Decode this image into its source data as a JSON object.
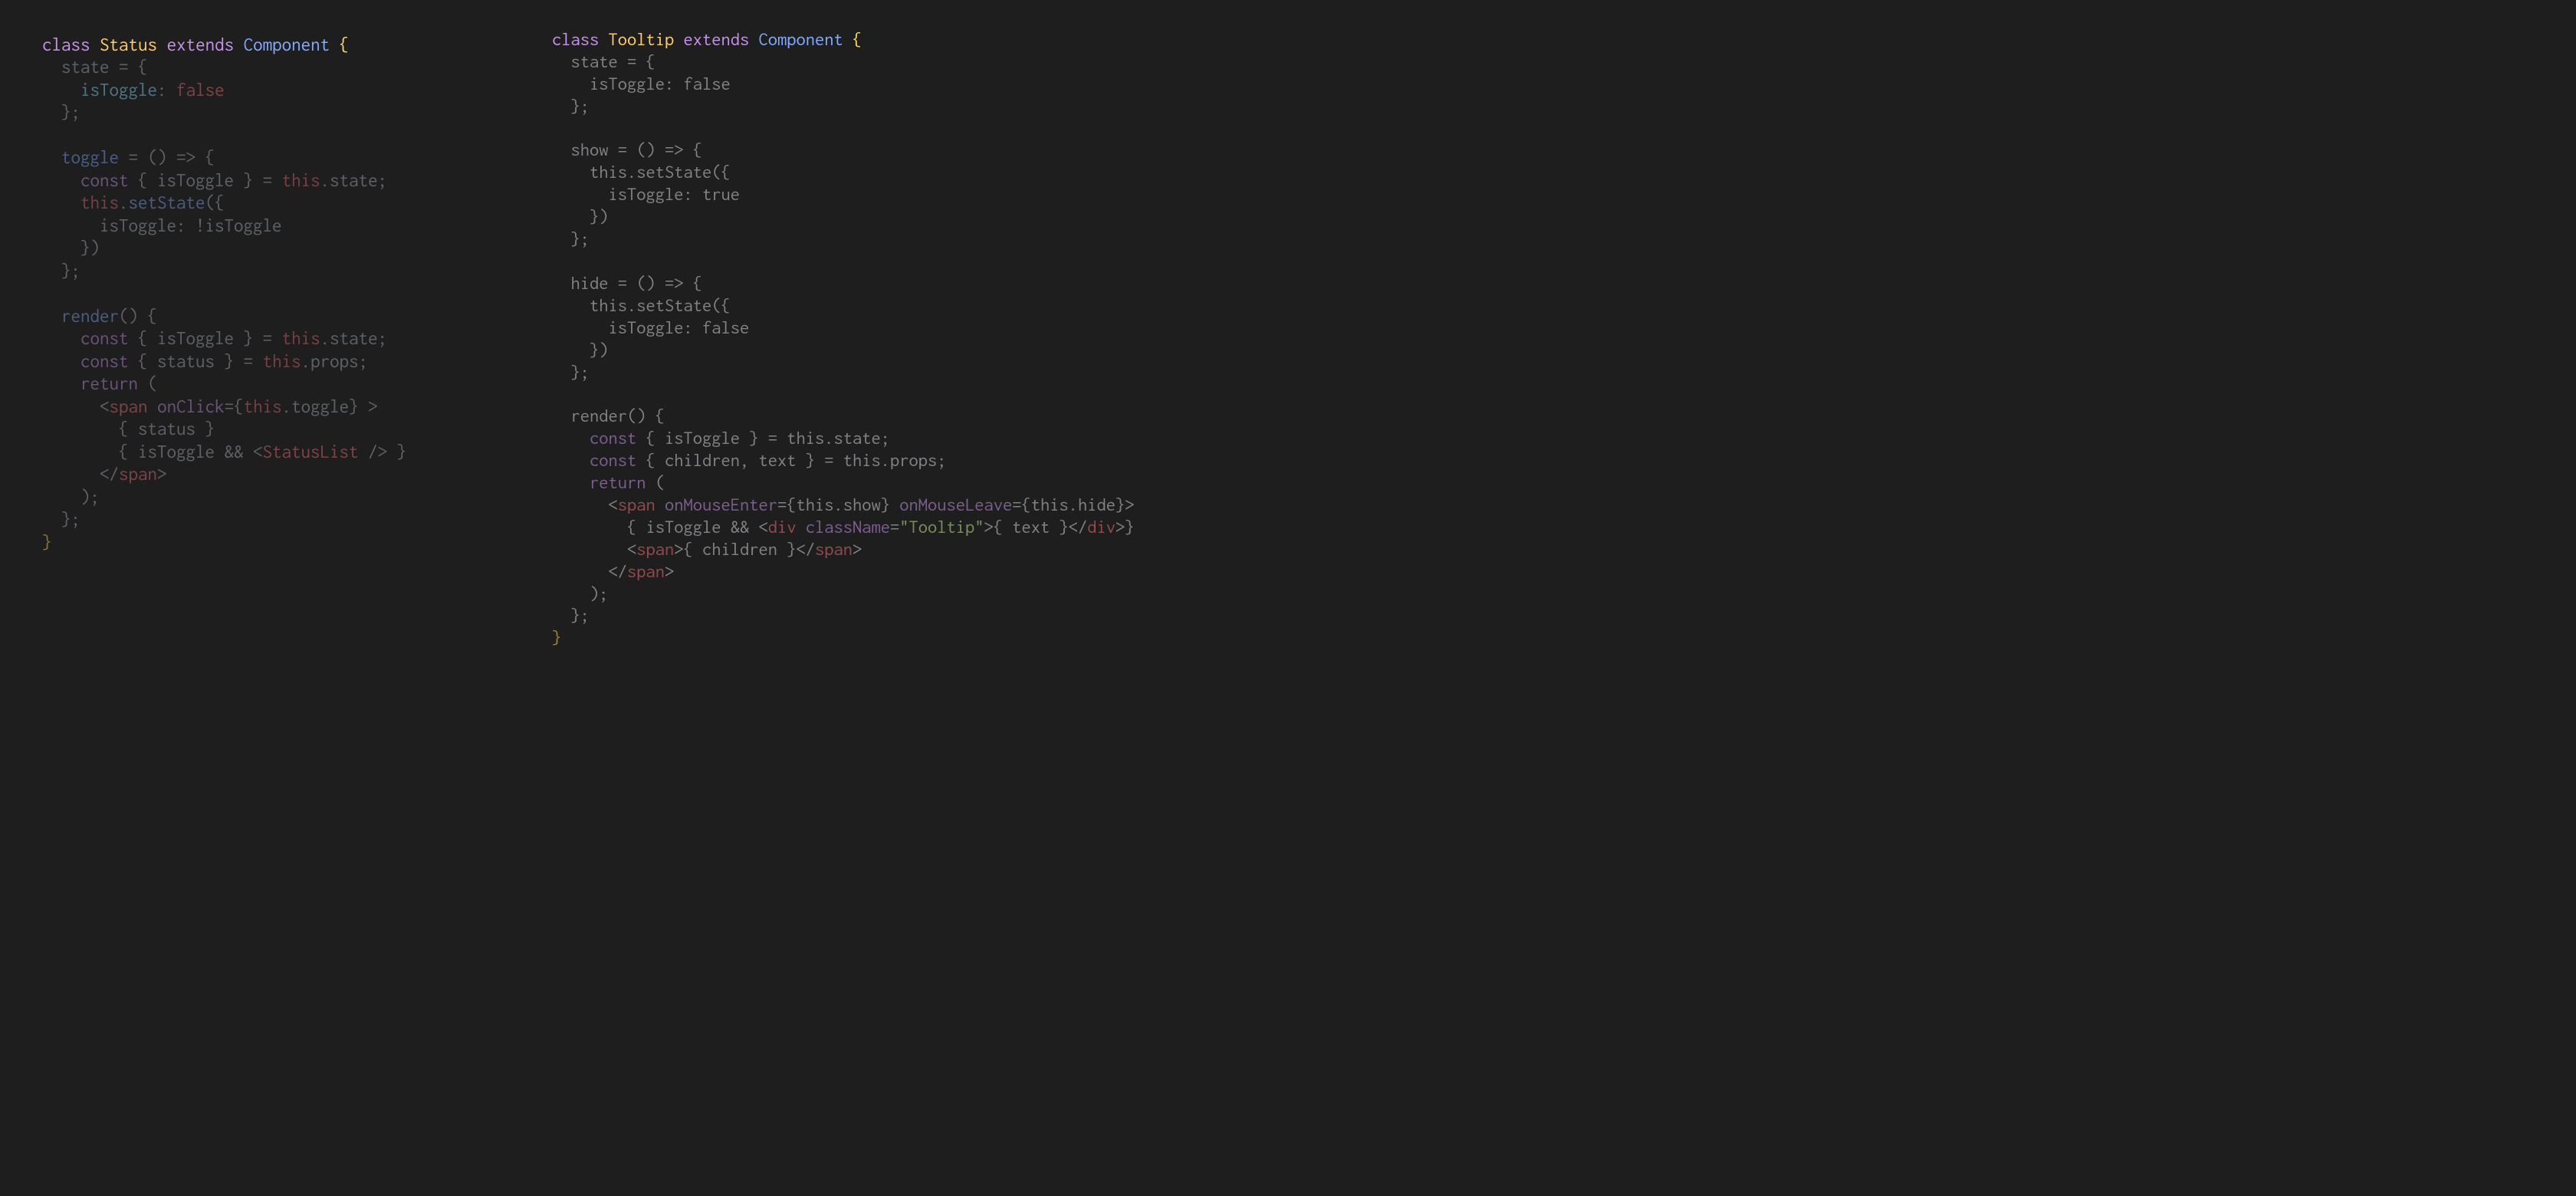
{
  "colors": {
    "background": "#1e1e1e",
    "keyword": "#c792ea",
    "className": "#ffcb6b",
    "type": "#82aaff",
    "property": "#89ddff",
    "literal": "#f07178",
    "tag": "#f07178",
    "attribute": "#c792ea",
    "string": "#c3e88d",
    "dim": "#5c6370",
    "default": "#abb2bf"
  },
  "left": {
    "class_name": "Status",
    "extends": "Component",
    "state_prop": "isToggle",
    "state_initial": "false",
    "method1_name": "toggle",
    "arrow": "() => {",
    "destructure_line": "const { isToggle } = this.state;",
    "setState_open": "this.setState({",
    "setState_body": "isToggle: !isToggle",
    "close_paren": "})",
    "render": "render",
    "render_body_1": "const { isToggle } = this.state;",
    "render_body_2": "const { status } = this.props;",
    "return": "return",
    "jsx_span_open": "<span onClick={this.toggle} >",
    "jsx_line1": "{ status }",
    "jsx_line2": "{ isToggle && <StatusList /> }",
    "jsx_span_close": "</span>"
  },
  "right": {
    "class_name": "Tooltip",
    "extends": "Component",
    "state_prop": "isToggle",
    "state_initial": "false",
    "show": "show",
    "hide": "hide",
    "arrow": "() => {",
    "setState_open": "this.setState({",
    "show_body": "isToggle: true",
    "hide_body": "isToggle: false",
    "close_paren": "})",
    "render": "render",
    "render_body_1": "const { isToggle } = this.state;",
    "render_body_2": "const { children, text } = this.props;",
    "return": "return",
    "jsx_span_open": "<span onMouseEnter={this.show} onMouseLeave={this.hide}>",
    "jsx_line1": "{ isToggle && <div className=\"Tooltip\">{ text }</div>}",
    "jsx_line2": "<span>{ children }</span>",
    "jsx_span_close": "</span>"
  }
}
